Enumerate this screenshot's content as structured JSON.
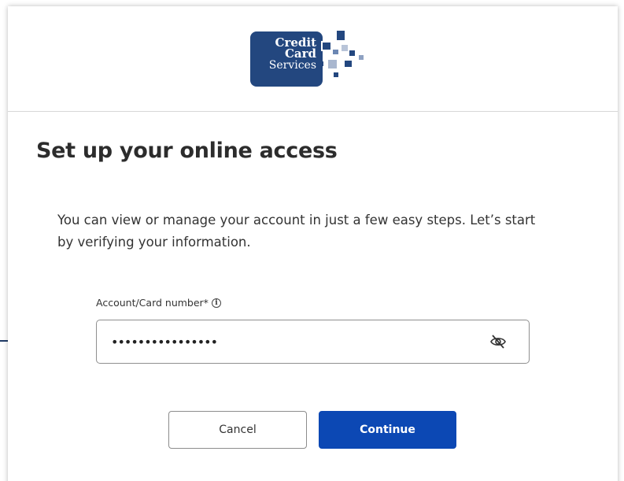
{
  "brand": {
    "logo_line1": "Credit",
    "logo_line2": "Card",
    "logo_line3": "Services",
    "primary_color": "#23477f"
  },
  "page": {
    "title": "Set up your online access",
    "description": "You can view or manage your account in just a few easy steps. Let’s start by verifying your information."
  },
  "form": {
    "account_label": "Account/Card number*",
    "info_icon_glyph": "i",
    "account_value": "••••••••••••••••",
    "visibility_icon": "eye-slash-icon"
  },
  "actions": {
    "cancel_label": "Cancel",
    "continue_label": "Continue",
    "continue_color": "#0c48b4"
  }
}
